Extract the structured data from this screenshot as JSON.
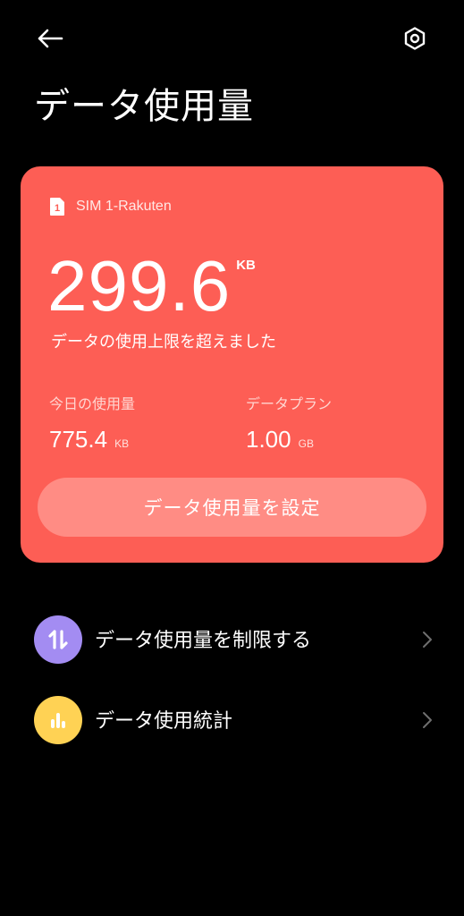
{
  "header": {
    "back_icon": "arrow-left-icon",
    "settings_icon": "hexagon-gear-icon",
    "title": "データ使用量"
  },
  "usage_card": {
    "background_color": "#fd5e55",
    "sim_icon": "sim-card-icon",
    "sim_icon_number": "1",
    "sim_label": "SIM 1-Rakuten",
    "usage_value": "299.6",
    "usage_unit": "KB",
    "warning": "データの使用上限を超えました",
    "today": {
      "label": "今日の使用量",
      "value": "775.4",
      "unit": "KB"
    },
    "plan": {
      "label": "データプラン",
      "value": "1.00",
      "unit": "GB"
    },
    "set_button_label": "データ使用量を設定"
  },
  "menu": [
    {
      "label": "データ使用量を制限する",
      "icon": "up-down-arrows-icon",
      "icon_color": "#a38cf2"
    },
    {
      "label": "データ使用統計",
      "icon": "bar-chart-icon",
      "icon_color": "#ffd254"
    }
  ]
}
